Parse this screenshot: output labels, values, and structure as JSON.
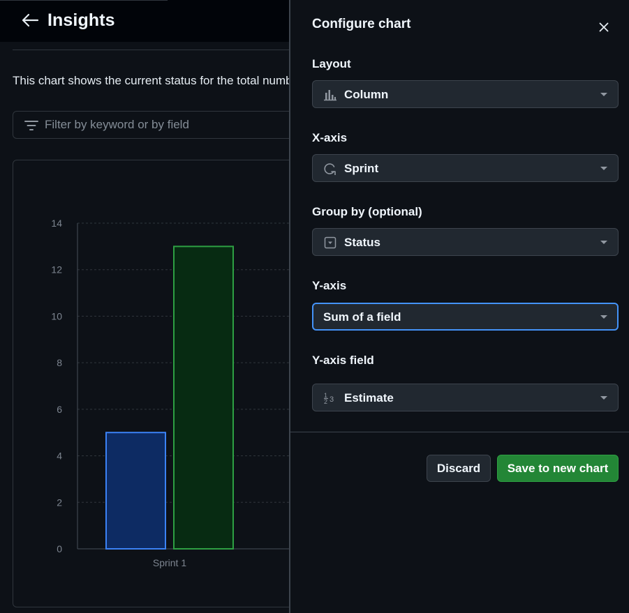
{
  "header": {
    "title": "Insights",
    "back_icon": "arrow-left-icon"
  },
  "page": {
    "description": "This chart shows the current status for the total number of items in your project.",
    "filter_placeholder": "Filter by keyword or by field"
  },
  "chart_data": {
    "type": "bar",
    "categories": [
      "Sprint 1"
    ],
    "series": [
      {
        "values": [
          5
        ],
        "color": "#0d2b63",
        "stroke": "#3b82f6"
      },
      {
        "values": [
          13
        ],
        "color": "#072b12",
        "stroke": "#2ea043"
      }
    ],
    "ylim": [
      0,
      14
    ],
    "yticks": [
      0,
      2,
      4,
      6,
      8,
      10,
      12,
      14
    ],
    "grid": true,
    "xlabel": "",
    "ylabel": ""
  },
  "panel": {
    "title": "Configure chart",
    "close_icon": "x-icon",
    "layout": {
      "label": "Layout",
      "value": "Column",
      "icon": "column-chart-icon"
    },
    "xaxis": {
      "label": "X-axis",
      "value": "Sprint",
      "icon": "iteration-icon"
    },
    "groupby": {
      "label": "Group by (optional)",
      "value": "Status",
      "icon": "single-select-icon"
    },
    "yaxis": {
      "label": "Y-axis",
      "value": "Sum of a field"
    },
    "yfield": {
      "label": "Y-axis field",
      "value": "Estimate",
      "icon": "number-icon"
    },
    "discard_label": "Discard",
    "save_label": "Save to new chart"
  },
  "colors": {
    "accent_blue": "#4493f8",
    "save_green": "#238636",
    "background": "#0d1117"
  }
}
